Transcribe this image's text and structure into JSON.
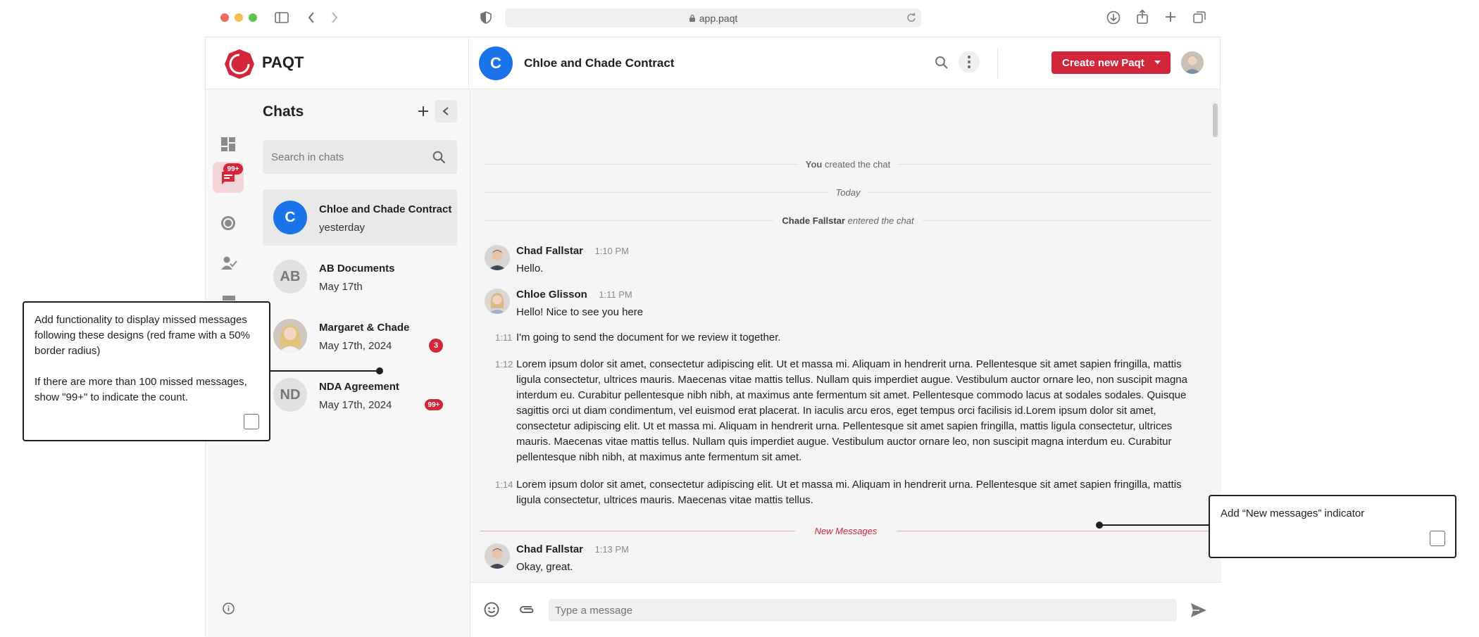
{
  "browser": {
    "url": "app.paqt"
  },
  "brand": {
    "name": "PAQT",
    "accent": "#d3263a"
  },
  "header": {
    "chat_initial": "C",
    "chat_title": "Chloe and Chade Contract",
    "create_button": "Create new Paqt"
  },
  "nav": {
    "chat_badge": "99+"
  },
  "chats": {
    "title": "Chats",
    "search_placeholder": "Search in chats",
    "items": [
      {
        "initials": "C",
        "name": "Chloe and Chade Contract",
        "date": "yesterday",
        "badge": ""
      },
      {
        "initials": "AB",
        "name": "AB Documents",
        "date": "May 17th",
        "badge": ""
      },
      {
        "initials": "",
        "name": "Margaret & Chade",
        "date": "May 17th, 2024",
        "badge": "3"
      },
      {
        "initials": "ND",
        "name": "NDA Agreement",
        "date": "May 17th, 2024",
        "badge": "99+"
      }
    ]
  },
  "conversation": {
    "sys_created_you": "You",
    "sys_created_rest": "created the chat",
    "sys_today": "Today",
    "sys_entered_name": "Chade Fallstar",
    "sys_entered_rest": "entered the chat",
    "messages": [
      {
        "name": "Chad Fallstar",
        "time": "1:10 PM",
        "text": "Hello."
      },
      {
        "name": "Chloe Glisson",
        "time": "1:11 PM",
        "text": "Hello! Nice to see you here"
      },
      {
        "time": "1:11",
        "text": "I'm going to send the document for we review it together."
      },
      {
        "time": "1:12",
        "text": "Lorem ipsum dolor sit amet, consectetur adipiscing elit. Ut et massa mi. Aliquam in hendrerit urna. Pellentesque sit amet sapien fringilla, mattis ligula consectetur, ultrices mauris. Maecenas vitae mattis tellus. Nullam quis imperdiet augue. Vestibulum auctor ornare leo, non suscipit magna interdum eu. Curabitur pellentesque nibh nibh, at maximus ante fermentum sit amet. Pellentesque commodo lacus at sodales sodales. Quisque sagittis orci ut diam condimentum, vel euismod erat placerat. In iaculis arcu eros, eget tempus orci facilisis id.Lorem ipsum dolor sit amet, consectetur adipiscing elit. Ut et massa mi. Aliquam in hendrerit urna. Pellentesque sit amet sapien fringilla, mattis ligula consectetur, ultrices mauris. Maecenas vitae mattis tellus. Nullam quis imperdiet augue. Vestibulum auctor ornare leo, non suscipit magna interdum eu. Curabitur pellentesque nibh nibh, at maximus ante fermentum sit amet."
      },
      {
        "time": "1:14",
        "text": "Lorem ipsum dolor sit amet, consectetur adipiscing elit. Ut et massa mi. Aliquam in hendrerit urna. Pellentesque sit amet sapien fringilla, mattis ligula consectetur, ultrices mauris. Maecenas vitae mattis tellus."
      },
      {
        "name": "Chad Fallstar",
        "time": "1:13 PM",
        "text": "Okay, great."
      }
    ],
    "new_messages": "New Messages",
    "composer_placeholder": "Type a message"
  },
  "annotations": {
    "left_p1": "Add functionality to display missed messages following these designs (red frame with a 50% border radius)",
    "left_p2": "If there are more than 100 missed messages, show \"99+\" to indicate the count.",
    "right": "Add “New messages”  indicator"
  }
}
